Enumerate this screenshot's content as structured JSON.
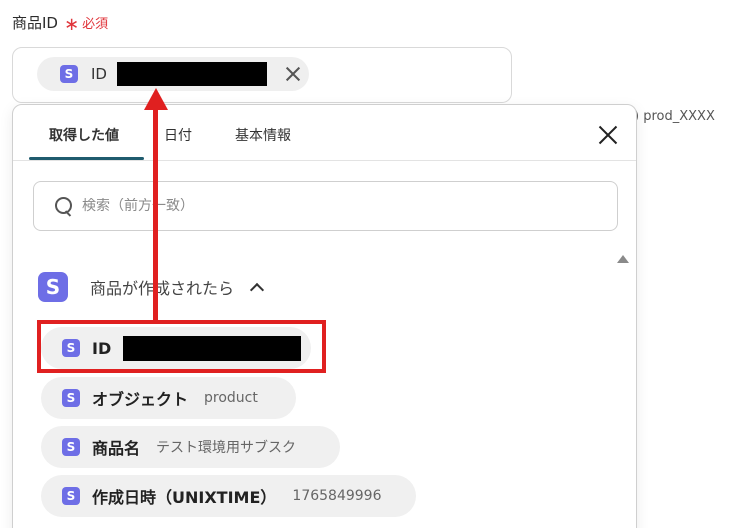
{
  "field": {
    "label": "商品ID",
    "required_star": "∗",
    "required_text": "必須",
    "chip": {
      "badge": "S",
      "label": "ID"
    },
    "hint": ") prod_XXXX"
  },
  "panel": {
    "tabs": [
      {
        "label": "取得した値",
        "active": true
      },
      {
        "label": "日付",
        "active": false
      },
      {
        "label": "基本情報",
        "active": false
      }
    ],
    "search_placeholder": "検索（前方一致）",
    "group": {
      "badge": "S",
      "title": "商品が作成されたら"
    },
    "items": [
      {
        "badge": "S",
        "label": "ID",
        "value": ""
      },
      {
        "badge": "S",
        "label": "オブジェクト",
        "value": "product"
      },
      {
        "badge": "S",
        "label": "商品名",
        "value": "テスト環境用サブスク"
      },
      {
        "badge": "S",
        "label": "作成日時（UNIXTIME）",
        "value": "1765849996"
      }
    ]
  },
  "colors": {
    "accent": "#1f5b6e",
    "stripe": "#6e6ee6",
    "annotation": "#e02020",
    "required": "#e0353b"
  }
}
